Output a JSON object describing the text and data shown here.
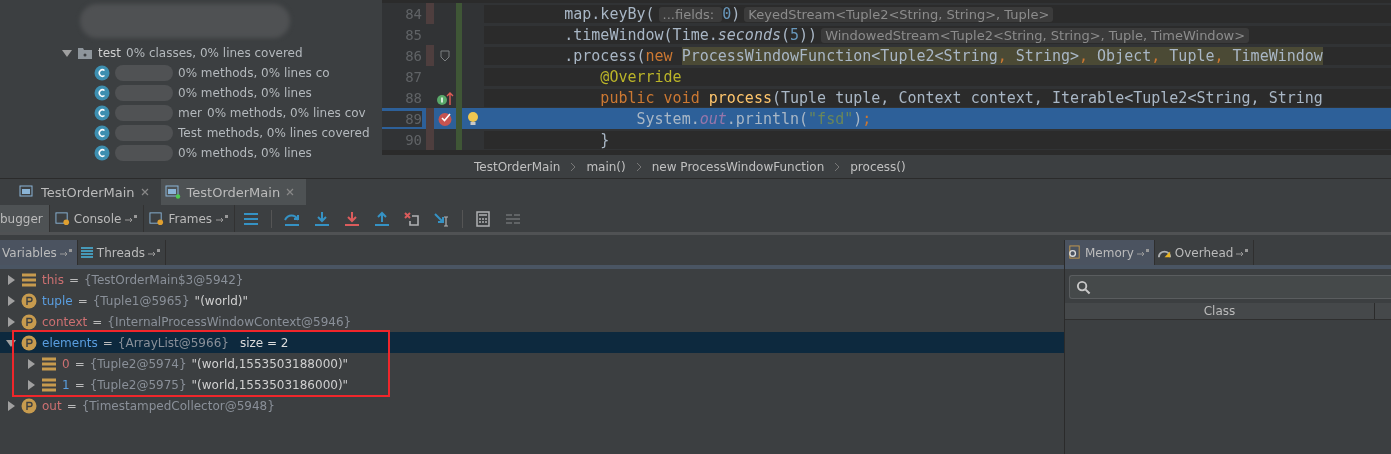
{
  "project_tree": {
    "folder": {
      "name": "test",
      "stats": "0% classes, 0% lines covered",
      "expanded": true
    },
    "rows": [
      {
        "parts": [
          "0% methods, 0% lines co"
        ]
      },
      {
        "parts": [
          "0% methods, 0% lines"
        ]
      },
      {
        "parts": [
          "mer",
          "0% methods, 0% lines cov"
        ]
      },
      {
        "parts": [
          "Test",
          "methods, 0% lines covered"
        ]
      },
      {
        "parts": [
          "0% methods, 0% lines"
        ]
      }
    ]
  },
  "editor": {
    "lines": [
      {
        "number": "84",
        "changed": true,
        "breakpoint": false,
        "implements": false,
        "folding": false,
        "current": false,
        "tokens": [
          {
            "kind": "plain",
            "text": "        map.keyBy("
          },
          {
            "kind": "hint",
            "text": "...fields: "
          },
          {
            "kind": "number",
            "text": "0"
          },
          {
            "kind": "plain",
            "text": ")"
          },
          {
            "kind": "hint",
            "text": "KeyedStream<Tuple2<String, String>, Tuple>"
          }
        ]
      },
      {
        "number": "85",
        "changed": false,
        "breakpoint": false,
        "implements": false,
        "folding": false,
        "current": false,
        "tokens": [
          {
            "kind": "plain",
            "text": "        .timeWindow(Time."
          },
          {
            "kind": "italic",
            "text": "seconds"
          },
          {
            "kind": "plain",
            "text": "("
          },
          {
            "kind": "number",
            "text": "5"
          },
          {
            "kind": "plain",
            "text": "))"
          },
          {
            "kind": "hint",
            "text": "WindowedStream<Tuple2<String, String>, Tuple, TimeWindow>"
          }
        ]
      },
      {
        "number": "86",
        "changed": true,
        "breakpoint": false,
        "implements": false,
        "folding": true,
        "current": false,
        "tokens": [
          {
            "kind": "plain",
            "text": "        .process("
          },
          {
            "kind": "keyword",
            "text": "new "
          },
          {
            "kind": "highlighted",
            "text": "ProcessWindowFunction<Tuple2<String"
          },
          {
            "kind": "highlighted-keyword",
            "text": ", "
          },
          {
            "kind": "highlighted",
            "text": "String>"
          },
          {
            "kind": "highlighted-keyword",
            "text": ", "
          },
          {
            "kind": "highlighted",
            "text": "Object"
          },
          {
            "kind": "highlighted-keyword",
            "text": ", "
          },
          {
            "kind": "highlighted",
            "text": "Tuple"
          },
          {
            "kind": "highlighted-keyword",
            "text": ", "
          },
          {
            "kind": "highlighted",
            "text": "TimeWindow"
          }
        ]
      },
      {
        "number": "87",
        "changed": false,
        "breakpoint": false,
        "implements": false,
        "folding": false,
        "current": false,
        "tokens": [
          {
            "kind": "annotation",
            "text": "            @Override"
          }
        ]
      },
      {
        "number": "88",
        "changed": false,
        "breakpoint": false,
        "implements": true,
        "folding": false,
        "current": false,
        "tokens": [
          {
            "kind": "keyword",
            "text": "            public void "
          },
          {
            "kind": "method",
            "text": "process"
          },
          {
            "kind": "plain",
            "text": "(Tuple tuple, Context context, Iterable<Tuple2<String, String"
          }
        ]
      },
      {
        "number": "89",
        "changed": true,
        "breakpoint": true,
        "implements": false,
        "folding": false,
        "current": true,
        "tokens": [
          {
            "kind": "plain",
            "text": "                System."
          },
          {
            "kind": "field",
            "text": "out"
          },
          {
            "kind": "plain",
            "text": ".println("
          },
          {
            "kind": "string",
            "text": "\"fsd\""
          },
          {
            "kind": "plain",
            "text": ")"
          },
          {
            "kind": "keyword",
            "text": ";"
          }
        ]
      },
      {
        "number": "90",
        "changed": true,
        "breakpoint": false,
        "implements": false,
        "folding": false,
        "current": false,
        "tokens": [
          {
            "kind": "plain",
            "text": "            }"
          }
        ]
      }
    ],
    "breadcrumbs": [
      "TestOrderMain",
      "main()",
      "new ProcessWindowFunction",
      "process()"
    ]
  },
  "run_tabs": [
    {
      "label": "TestOrderMain",
      "selected": false
    },
    {
      "label": "TestOrderMain",
      "selected": true
    }
  ],
  "debug_tabs": [
    {
      "label": "bugger",
      "selected": true
    },
    {
      "label": "Console",
      "selected": false
    },
    {
      "label": "Frames",
      "selected": false
    }
  ],
  "variables_tabs": [
    {
      "label": "Variables",
      "selected": true
    },
    {
      "label": "Threads",
      "selected": false
    }
  ],
  "variables": [
    {
      "kind": "field",
      "name": "this",
      "eq": "=",
      "color": "#cc7071",
      "value": "{TestOrderMain$3@5942}",
      "expanded": false,
      "selected": false,
      "highlighted": false
    },
    {
      "kind": "param",
      "name": "tuple",
      "eq": "=",
      "color": "#5a9ee0",
      "value": "{Tuple1@5965}",
      "string": "\"(world)\"",
      "expanded": false,
      "selected": false,
      "highlighted": false
    },
    {
      "kind": "param",
      "name": "context",
      "eq": "=",
      "color": "#cc7071",
      "value": "{InternalProcessWindowContext@5946}",
      "expanded": false,
      "selected": false,
      "highlighted": false
    },
    {
      "kind": "param",
      "name": "elements",
      "eq": "=",
      "color": "#5a9ee0",
      "value": "{ArrayList@5966}",
      "extra": "size = 2",
      "expanded": true,
      "selected": true,
      "highlighted": true,
      "children": [
        {
          "kind": "field",
          "name": "0",
          "eq": "=",
          "color": "#cc7071",
          "value": "{Tuple2@5974}",
          "string": "\"(world,1553503188000)\"",
          "expanded": false,
          "selected": false
        },
        {
          "kind": "field",
          "name": "1",
          "eq": "=",
          "color": "#5a9ee0",
          "value": "{Tuple2@5975}",
          "string": "\"(world,1553503186000)\"",
          "expanded": false,
          "selected": false
        }
      ]
    },
    {
      "kind": "param",
      "name": "out",
      "eq": "=",
      "color": "#cc7071",
      "value": "{TimestampedCollector@5948}",
      "expanded": false,
      "selected": false,
      "highlighted": false
    }
  ],
  "memory_tabs": [
    {
      "label": "Memory",
      "selected": true
    },
    {
      "label": "Overhead",
      "selected": false
    }
  ],
  "memory_table": {
    "columns": [
      "Class"
    ]
  }
}
